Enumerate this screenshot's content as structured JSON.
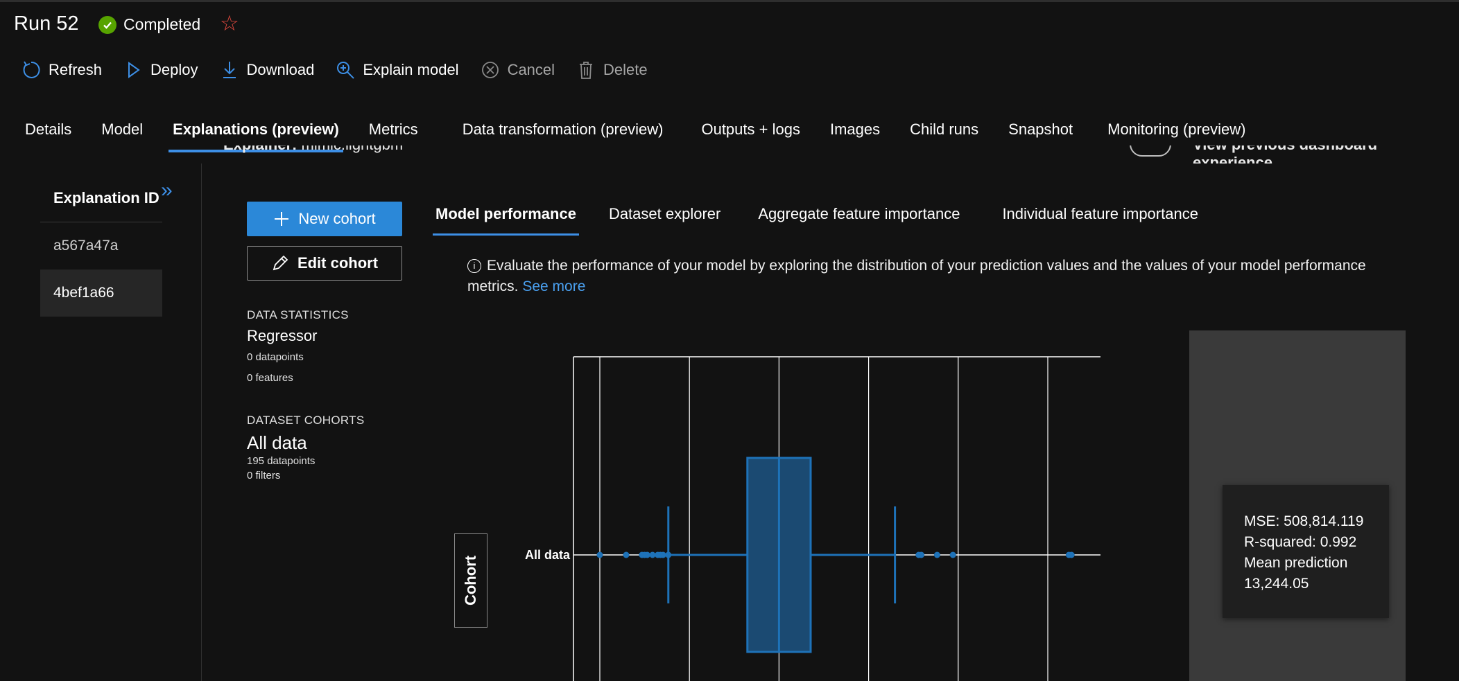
{
  "header": {
    "title": "Run 52",
    "status": "Completed",
    "colors": {
      "status": "#57a300",
      "favorite": "#e0483e",
      "accent": "#2b88d8"
    }
  },
  "toolbar": {
    "refresh": "Refresh",
    "deploy": "Deploy",
    "download": "Download",
    "explain": "Explain model",
    "cancel": "Cancel",
    "delete": "Delete"
  },
  "tabs": [
    "Details",
    "Model",
    "Explanations (preview)",
    "Metrics",
    "Data transformation (preview)",
    "Outputs + logs",
    "Images",
    "Child runs",
    "Snapshot",
    "Monitoring (preview)"
  ],
  "active_tab": "Explanations (preview)",
  "explainer": {
    "label": "Explainer:",
    "value": "mimic.lightgbm",
    "toggle_label": "View previous dashboard experience"
  },
  "explanation_panel": {
    "header": "Explanation ID",
    "items": [
      "a567a47a",
      "4bef1a66"
    ],
    "selected": "4bef1a66"
  },
  "cohort": {
    "new_label": "New cohort",
    "edit_label": "Edit cohort"
  },
  "data_statistics": {
    "label": "DATA STATISTICS",
    "type": "Regressor",
    "datapoints": "0 datapoints",
    "features": "0 features"
  },
  "dataset_cohorts": {
    "label": "DATASET COHORTS",
    "name": "All data",
    "datapoints": "195 datapoints",
    "filters": "0 filters"
  },
  "subtabs": [
    "Model performance",
    "Dataset explorer",
    "Aggregate feature importance",
    "Individual feature importance"
  ],
  "active_subtab": "Model performance",
  "description": {
    "text": "Evaluate the performance of your model by exploring the distribution of your prediction values and the values of your model performance metrics.",
    "link": "See more"
  },
  "chart_data": {
    "type": "box",
    "category": "All data",
    "y_axis_button": "Cohort",
    "box": {
      "whisker_low": 0.18,
      "q1": 0.33,
      "median": 0.39,
      "q3": 0.45,
      "whisker_high": 0.61
    },
    "outliers": [
      0.05,
      0.1,
      0.13,
      0.135,
      0.14,
      0.15,
      0.16,
      0.165,
      0.17,
      0.18,
      0.655,
      0.66,
      0.69,
      0.72,
      0.94,
      0.945
    ],
    "grid": true,
    "series_color": "#1e72b8"
  },
  "metrics": {
    "mse": "MSE: 508,814.119",
    "r2": "R-squared: 0.992",
    "mean_label": "Mean prediction",
    "mean_value": "13,244.05"
  }
}
